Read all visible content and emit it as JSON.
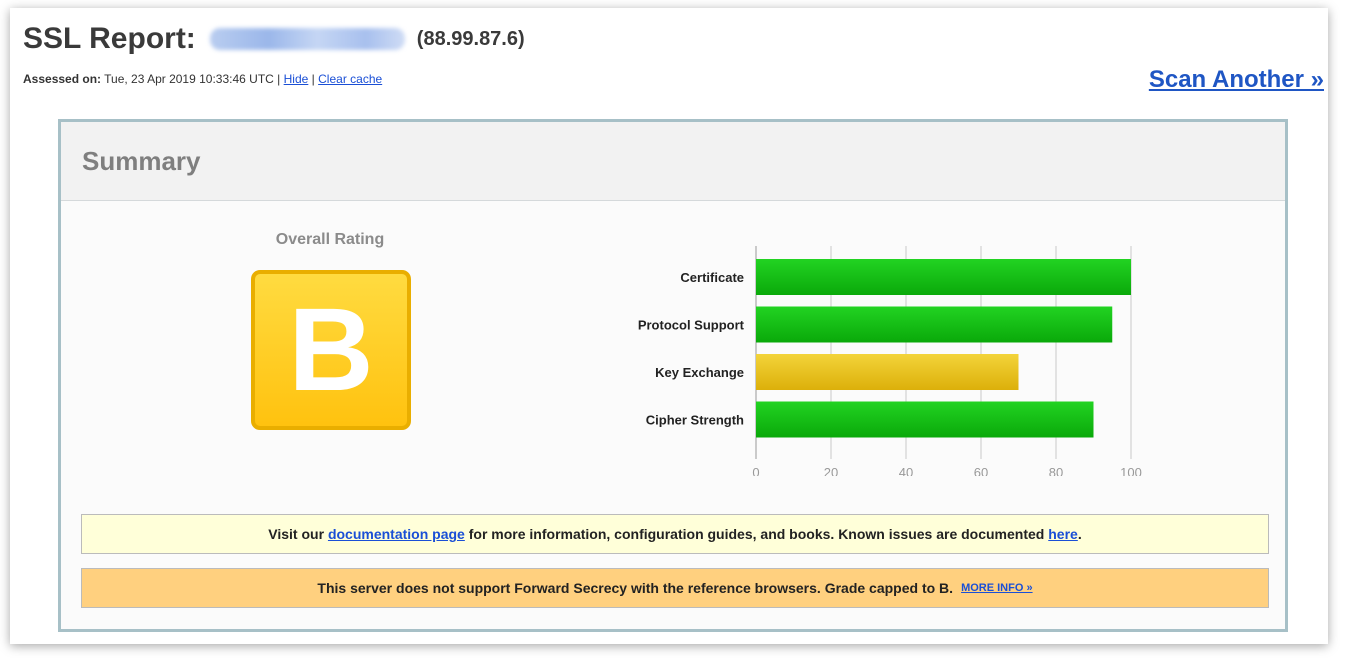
{
  "header": {
    "title": "SSL Report:",
    "ip": "(88.99.87.6)",
    "assessed_label": "Assessed on:",
    "assessed_value": "Tue, 23 Apr 2019 10:33:46 UTC",
    "separator": "|",
    "hide_link": "Hide",
    "clear_cache_link": "Clear cache",
    "scan_another": "Scan Another »"
  },
  "summary": {
    "title": "Summary",
    "overall_label": "Overall Rating",
    "grade": "B",
    "grade_color": "#ffc20f"
  },
  "chart_data": {
    "type": "bar",
    "orientation": "horizontal",
    "categories": [
      "Certificate",
      "Protocol Support",
      "Key Exchange",
      "Cipher Strength"
    ],
    "values": [
      100,
      95,
      70,
      90
    ],
    "colors": [
      "#11b811",
      "#11b811",
      "#e3b80d",
      "#11b811"
    ],
    "xlim": [
      0,
      100
    ],
    "xticks": [
      "0",
      "20",
      "40",
      "60",
      "80",
      "100"
    ],
    "grid": true
  },
  "info_bar": {
    "text_before": "Visit our",
    "doc_link": "documentation page",
    "text_middle": "for more information, configuration guides, and books. Known issues are documented",
    "here_link": "here",
    "text_end": "."
  },
  "warning_bar": {
    "text": "This server does not support Forward Secrecy with the reference browsers. Grade capped to B.",
    "more_info": "MORE INFO »"
  }
}
